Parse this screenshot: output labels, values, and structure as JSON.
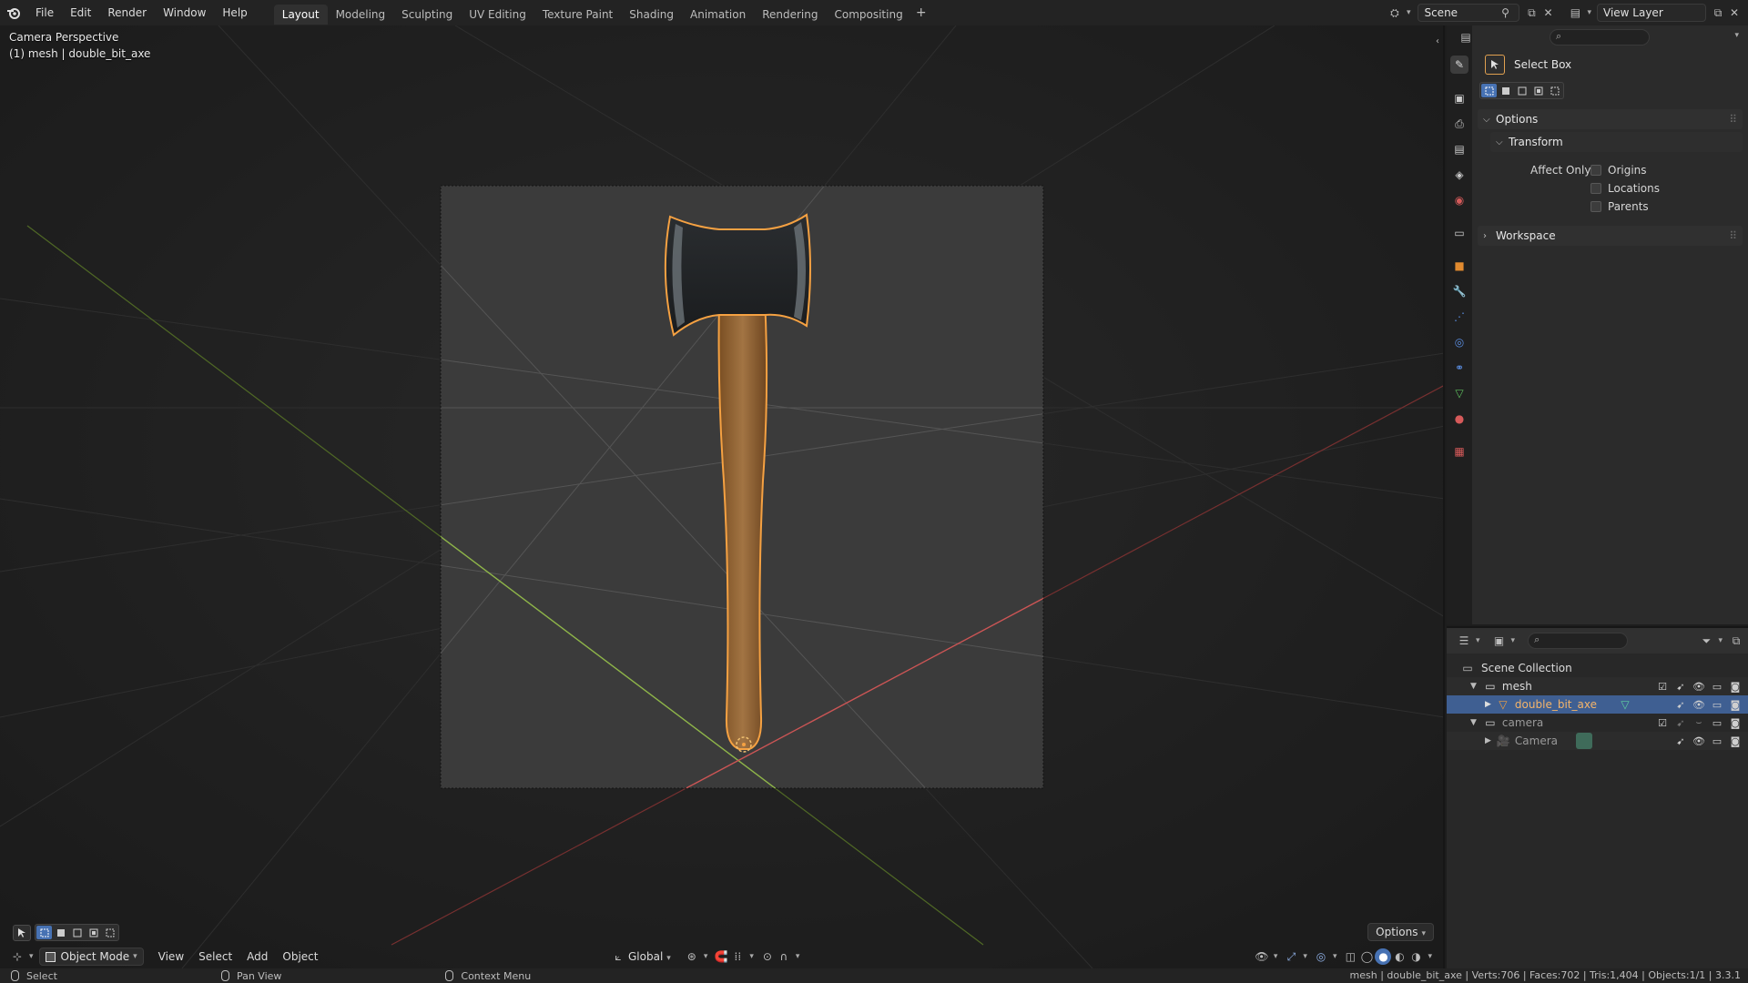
{
  "app": {
    "menus": [
      "File",
      "Edit",
      "Render",
      "Window",
      "Help"
    ],
    "workspaces": [
      "Layout",
      "Modeling",
      "Sculpting",
      "UV Editing",
      "Texture Paint",
      "Shading",
      "Animation",
      "Rendering",
      "Compositing"
    ],
    "active_workspace": "Layout",
    "add_workspace": "+",
    "scene_name": "Scene",
    "view_layer": "View Layer"
  },
  "viewport": {
    "perspective_label": "Camera Perspective",
    "object_label": "(1) mesh | double_bit_axe",
    "mode": "Object Mode",
    "menus": [
      "View",
      "Select",
      "Add",
      "Object"
    ],
    "orientation": "Global",
    "options_label": "Options"
  },
  "properties": {
    "tool_name": "Select Box",
    "options_header": "Options",
    "transform_header": "Transform",
    "affect_only_label": "Affect Only",
    "checkboxes": [
      "Origins",
      "Locations",
      "Parents"
    ],
    "workspace_header": "Workspace"
  },
  "outliner": {
    "root": "Scene Collection",
    "rows": [
      {
        "label": "mesh"
      },
      {
        "label": "double_bit_axe"
      },
      {
        "label": "camera"
      },
      {
        "label": "Camera"
      }
    ]
  },
  "statusbar": {
    "left": [
      "Select",
      "Pan View",
      "Context Menu"
    ],
    "stats": "mesh | double_bit_axe | Verts:706 | Faces:702 | Tris:1,404 | Objects:1/1 | 3.3.1"
  },
  "colors": {
    "accent": "#4772b3",
    "selection_outline": "#f5a142",
    "x_axis": "#b84a4a",
    "y_axis": "#7ba23a"
  }
}
